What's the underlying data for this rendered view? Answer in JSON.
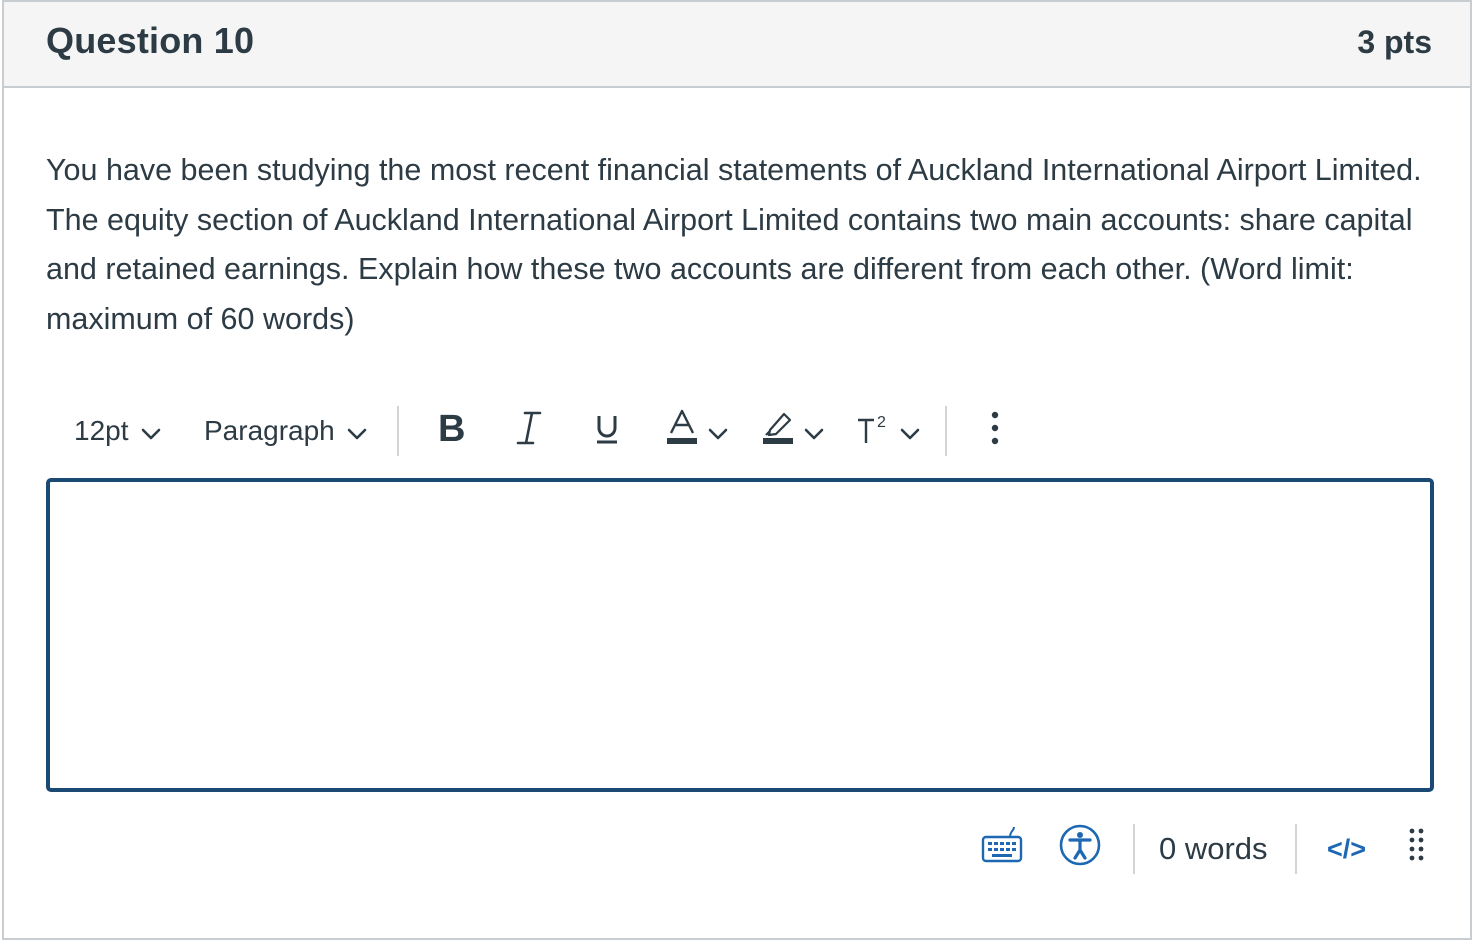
{
  "question": {
    "title": "Question 10",
    "points": "3 pts",
    "text": "You have been studying the most recent financial statements of Auckland International Airport Limited. The equity section of Auckland International Airport Limited contains two main accounts: share capital and retained earnings. Explain how these two accounts are different from each other. (Word limit: maximum of 60 words)"
  },
  "toolbar": {
    "font_size": "12pt",
    "block_format": "Paragraph",
    "icons": [
      "bold-icon",
      "italic-icon",
      "underline-icon",
      "text-color-icon",
      "highlight-icon",
      "superscript-icon",
      "more-options-icon"
    ]
  },
  "editor": {
    "content": ""
  },
  "statusbar": {
    "word_count": "0 words",
    "html_toggle": "</>",
    "icons": [
      "keyboard-icon",
      "accessibility-icon",
      "resize-handle-icon"
    ]
  },
  "colors": {
    "text": "#2d3b45",
    "header_bg": "#f5f5f5",
    "border": "#c7cdd1",
    "editor_focus_border": "#1a4a74",
    "link": "#1d67b3"
  }
}
